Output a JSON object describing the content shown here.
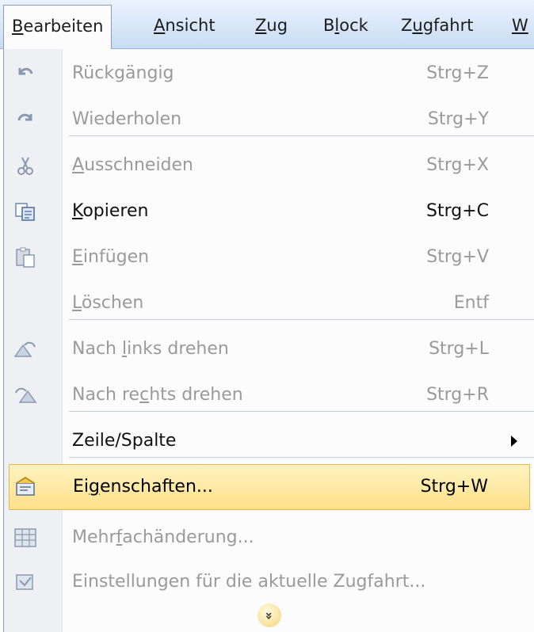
{
  "menubar": {
    "items": [
      {
        "pre": "",
        "acc": "B",
        "post": "earbeiten",
        "open": true
      },
      {
        "pre": "",
        "acc": "A",
        "post": "nsicht"
      },
      {
        "pre": "",
        "acc": "Z",
        "post": "ug"
      },
      {
        "pre": "B",
        "acc": "l",
        "post": "ock"
      },
      {
        "pre": "Z",
        "acc": "u",
        "post": "gfahrt"
      },
      {
        "pre": "",
        "acc": "W",
        "post": ""
      }
    ]
  },
  "menu": {
    "items": [
      {
        "pre": "Rückgängig",
        "acc": "",
        "post": "",
        "shortcut": "Strg+Z",
        "state": "disabled",
        "icon": "undo-icon"
      },
      {
        "pre": "Wiederholen",
        "acc": "",
        "post": "",
        "shortcut": "Strg+Y",
        "state": "disabled",
        "icon": "redo-icon"
      },
      {
        "pre": "",
        "acc": "A",
        "post": "usschneiden",
        "shortcut": "Strg+X",
        "state": "disabled",
        "icon": "scissors-icon"
      },
      {
        "pre": "",
        "acc": "K",
        "post": "opieren",
        "shortcut": "Strg+C",
        "state": "enabled",
        "icon": "copy-icon"
      },
      {
        "pre": "",
        "acc": "E",
        "post": "infügen",
        "shortcut": "Strg+V",
        "state": "disabled",
        "icon": "paste-icon"
      },
      {
        "pre": "",
        "acc": "L",
        "post": "öschen",
        "shortcut": "Entf",
        "state": "disabled",
        "icon": ""
      },
      {
        "pre": "Nach ",
        "acc": "l",
        "post": "inks drehen",
        "shortcut": "Strg+L",
        "state": "disabled",
        "icon": "rotate-left-icon"
      },
      {
        "pre": "Nach re",
        "acc": "c",
        "post": "hts drehen",
        "shortcut": "Strg+R",
        "state": "disabled",
        "icon": "rotate-right-icon"
      },
      {
        "pre": "Zeile/Spalte",
        "acc": "",
        "post": "",
        "shortcut": "",
        "state": "enabled",
        "icon": "",
        "submenu": true
      },
      {
        "pre": "Ei",
        "acc": "g",
        "post": "enschaften...",
        "shortcut": "Strg+W",
        "state": "highlight",
        "icon": "properties-icon"
      },
      {
        "pre": "Mehr",
        "acc": "f",
        "post": "achänderung...",
        "shortcut": "",
        "state": "disabled",
        "icon": "multi-edit-icon"
      },
      {
        "pre": "Einstellungen für die aktuelle Zugfahrt...",
        "acc": "",
        "post": "",
        "shortcut": "",
        "state": "disabled",
        "icon": "train-settings-icon"
      }
    ],
    "expand_glyph": "»"
  }
}
